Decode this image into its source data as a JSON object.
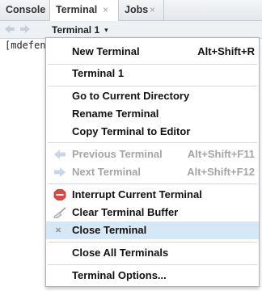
{
  "tabs": [
    {
      "label": "Console",
      "closable": false
    },
    {
      "label": "Terminal",
      "close_glyph": "×"
    },
    {
      "label": "Jobs",
      "close_glyph": "×"
    }
  ],
  "toolbar": {
    "terminal_select_label": "Terminal 1",
    "caret_glyph": "▾"
  },
  "console": {
    "prompt_text": "[mdefen"
  },
  "menu": {
    "items": [
      {
        "label": "New Terminal",
        "shortcut": "Alt+Shift+R",
        "enabled": true
      },
      {
        "label": "Terminal 1",
        "enabled": true
      },
      {
        "label": "Go to Current Directory",
        "enabled": true
      },
      {
        "label": "Rename Terminal",
        "enabled": true
      },
      {
        "label": "Copy Terminal to Editor",
        "enabled": true
      },
      {
        "label": "Previous Terminal",
        "shortcut": "Alt+Shift+F11",
        "enabled": false,
        "icon": "left-arrow-icon"
      },
      {
        "label": "Next Terminal",
        "shortcut": "Alt+Shift+F12",
        "enabled": false,
        "icon": "right-arrow-icon"
      },
      {
        "label": "Interrupt Current Terminal",
        "enabled": true,
        "icon": "stop-icon"
      },
      {
        "label": "Clear Terminal Buffer",
        "enabled": true,
        "icon": "broom-icon"
      },
      {
        "label": "Close Terminal",
        "enabled": true,
        "highlighted": true,
        "icon": "close-x-icon"
      },
      {
        "label": "Close All Terminals",
        "enabled": true
      },
      {
        "label": "Terminal Options...",
        "enabled": true
      }
    ]
  },
  "colors": {
    "highlight": "#d6e7f6",
    "disabled_text": "#a5a5a5",
    "stop_icon": "#e0473f"
  }
}
